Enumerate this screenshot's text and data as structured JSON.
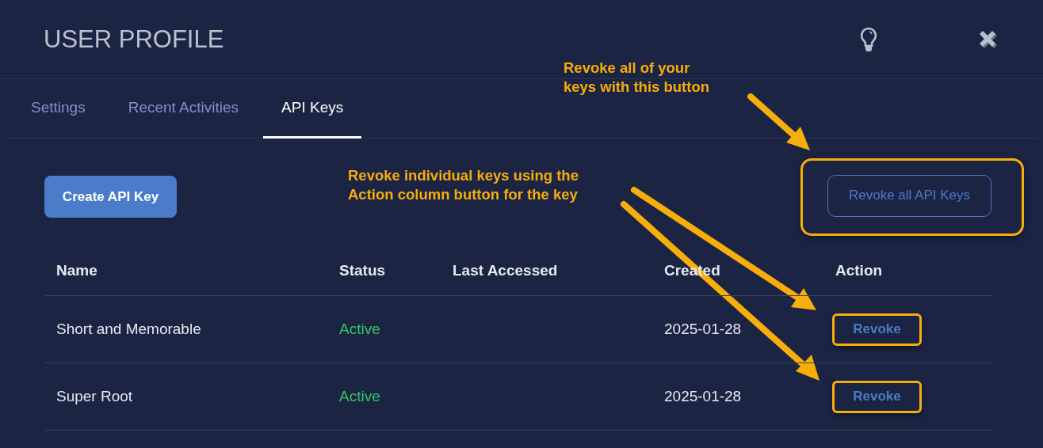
{
  "header": {
    "title": "USER PROFILE"
  },
  "tabs": [
    {
      "label": "Settings",
      "selected": false
    },
    {
      "label": "Recent Activities",
      "selected": false
    },
    {
      "label": "API Keys",
      "selected": true
    }
  ],
  "create_button": "Create API Key",
  "revoke_all_button": {
    "label": "Revoke all API Keys",
    "highlighted": true
  },
  "table": {
    "columns": [
      "Name",
      "Status",
      "Last Accessed",
      "Created",
      "Action"
    ],
    "rows": [
      {
        "name": "Short and Memorable",
        "status": "Active",
        "created": "2025-01-28",
        "action": "Revoke",
        "highlighted": true
      },
      {
        "name": "Super Root",
        "status": "Active",
        "created": "2025-01-28",
        "action": "Revoke",
        "highlighted": true
      }
    ]
  },
  "annotations": [
    {
      "text": "Revoke all of your\nkeys with this button"
    },
    {
      "text": "Revoke individual keys using the\nAction column button for the key"
    }
  ]
}
